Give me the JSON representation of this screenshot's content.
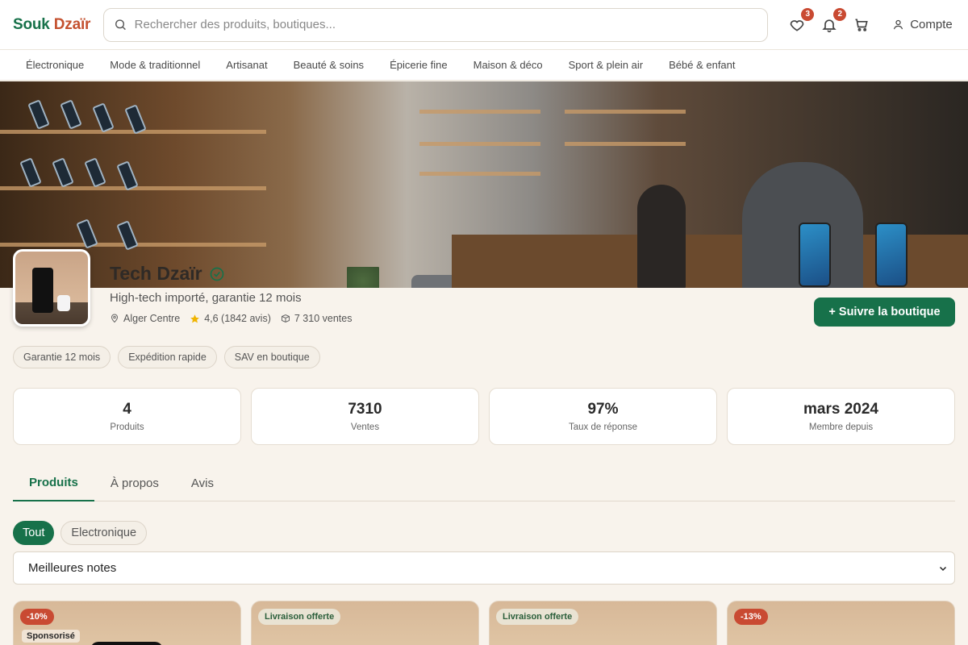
{
  "header": {
    "logo_part1": "Souk",
    "logo_part2": "Dzaïr",
    "search_placeholder": "Rechercher des produits, boutiques...",
    "wishlist_count": "3",
    "notifications_count": "2",
    "account_label": "Compte"
  },
  "categories": [
    "Électronique",
    "Mode & traditionnel",
    "Artisanat",
    "Beauté & soins",
    "Épicerie fine",
    "Maison & déco",
    "Sport & plein air",
    "Bébé & enfant"
  ],
  "shop": {
    "name": "Tech Dzaïr",
    "tagline": "High-tech importé, garantie 12 mois",
    "location": "Alger Centre",
    "rating": "4,6 (1842 avis)",
    "sales": "7 310 ventes",
    "follow_label": "+ Suivre la boutique",
    "chips": [
      "Garantie 12 mois",
      "Expédition rapide",
      "SAV en boutique"
    ]
  },
  "stats": [
    {
      "value": "4",
      "label": "Produits"
    },
    {
      "value": "7310",
      "label": "Ventes"
    },
    {
      "value": "97%",
      "label": "Taux de réponse"
    },
    {
      "value": "mars 2024",
      "label": "Membre depuis"
    }
  ],
  "tabs": [
    "Produits",
    "À propos",
    "Avis"
  ],
  "filters": [
    "Tout",
    "Electronique"
  ],
  "sort_selected": "Meilleures notes",
  "products": [
    {
      "badge": "-10%",
      "badge_type": "discount",
      "sponsored": "Sponsorisé"
    },
    {
      "badge": "Livraison offerte",
      "badge_type": "shipping"
    },
    {
      "badge": "Livraison offerte",
      "badge_type": "shipping"
    },
    {
      "badge": "-13%",
      "badge_type": "discount"
    }
  ],
  "colors": {
    "brand_green": "#17714a",
    "brand_red": "#c4512f",
    "background": "#f8f3ec"
  }
}
